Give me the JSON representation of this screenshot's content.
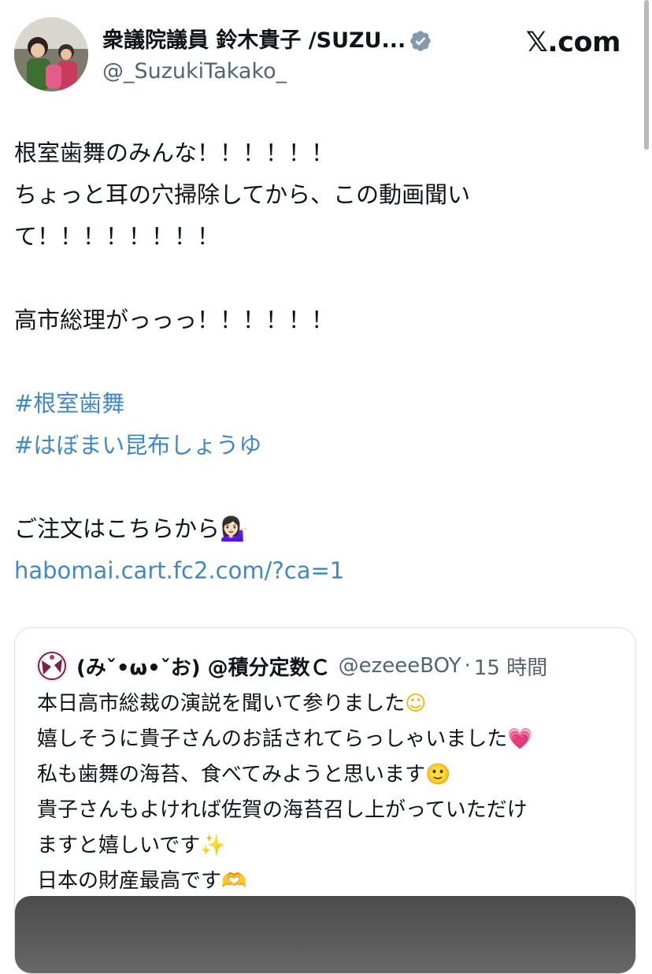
{
  "header": {
    "display_name": "衆議院議員 鈴木貴子 /SUZU...",
    "handle": "@_SuzukiTakako_",
    "brand": "𝕏.com"
  },
  "tweet": {
    "line1": "根室歯舞のみんな！！！！！！",
    "line2": "ちょっと耳の穴掃除してから、この動画聞い",
    "line3": "て！！！！！！！！",
    "line4": "高市総理がっっっ！！！！！！",
    "hashtag1": "#根室歯舞",
    "hashtag2": "#はぼまい昆布しょうゆ",
    "order_text": "ご注文はこちらから",
    "order_emoji": "💁🏻‍♀️",
    "link": "habomai.cart.fc2.com/?ca=1"
  },
  "quote": {
    "name": "(みˇ•ω•ˇお) @積分定数Ｃ",
    "handle": "@ezeeeBOY",
    "separator": "·",
    "time": "15 時間",
    "lines": [
      {
        "text": "本日高市総裁の演説を聞いて参りました",
        "emoji": "☺"
      },
      {
        "text": "嬉しそうに貴子さんのお話されてらっしゃいました",
        "emoji": "💗"
      },
      {
        "text": "私も歯舞の海苔、食べてみようと思います",
        "emoji": "🙂"
      },
      {
        "text": "貴子さんもよければ佐賀の海苔召し上がっていただけ",
        "emoji": ""
      },
      {
        "text": "ますと嬉しいです",
        "emoji": "✨"
      },
      {
        "text": "日本の財産最高です",
        "emoji": "🫶"
      }
    ]
  },
  "icons": {
    "verified": "verified-badge-icon",
    "avatar": "profile-avatar",
    "quote_avatar": "quote-profile-avatar"
  },
  "colors": {
    "link": "#4088c6",
    "secondary_text": "#536471",
    "verified_badge": "#829aab"
  }
}
